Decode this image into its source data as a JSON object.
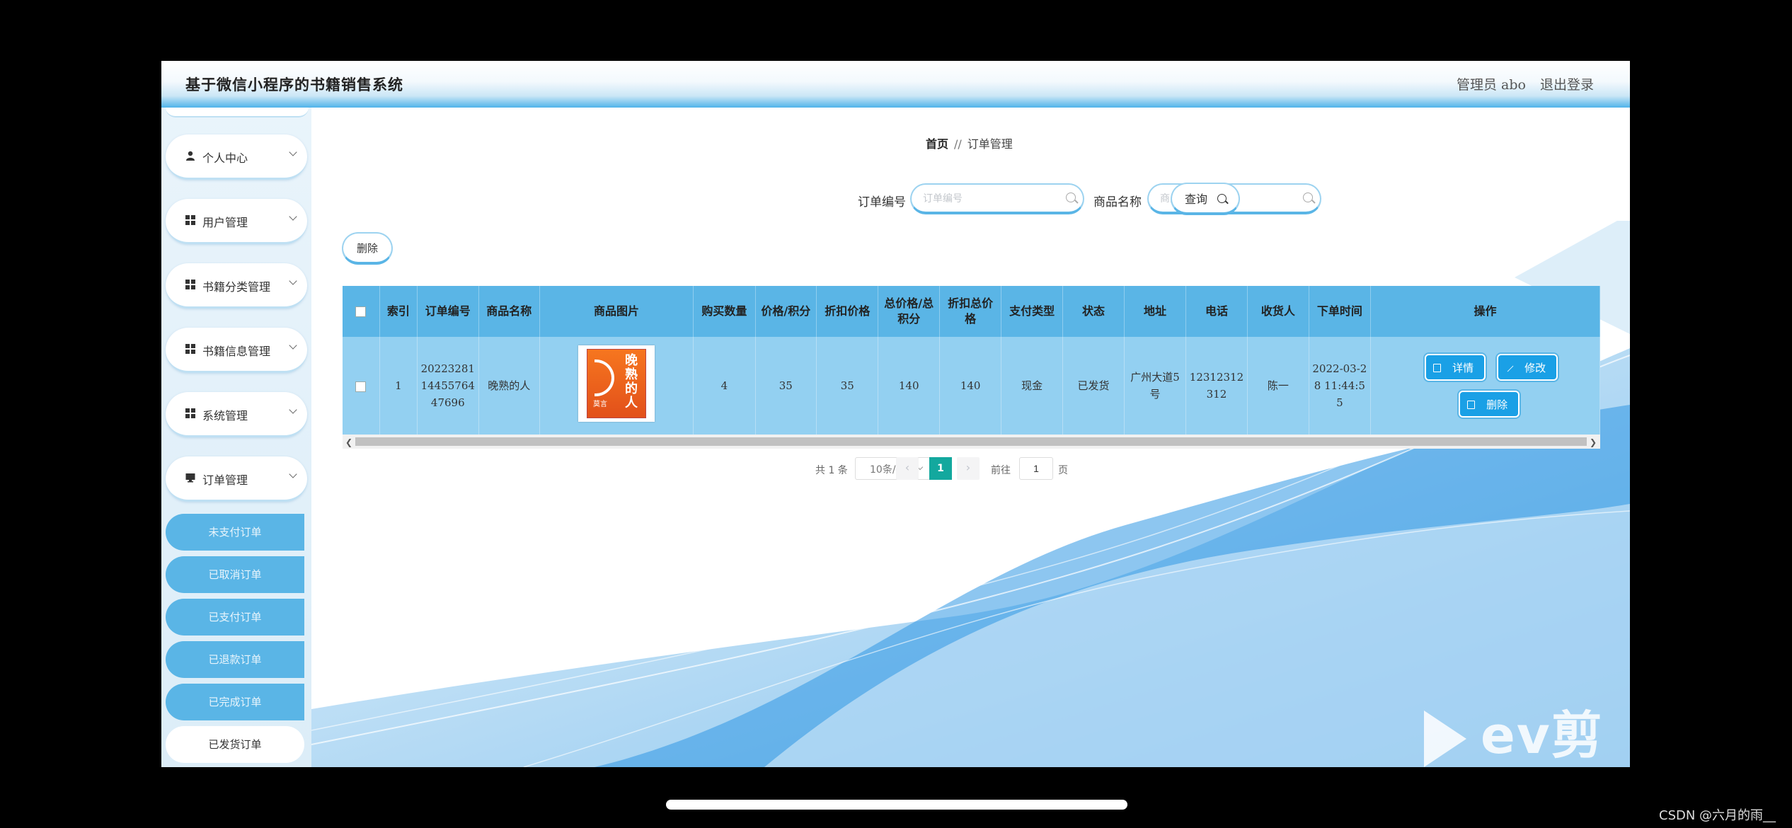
{
  "header": {
    "title": "基于微信小程序的书籍销售系统",
    "admin_label": "管理员 abo",
    "logout": "退出登录"
  },
  "sidebar": {
    "items": [
      {
        "label": "个人中心",
        "icon": "user-icon"
      },
      {
        "label": "用户管理",
        "icon": "grid-icon"
      },
      {
        "label": "书籍分类管理",
        "icon": "grid-icon"
      },
      {
        "label": "书籍信息管理",
        "icon": "grid-icon"
      },
      {
        "label": "系统管理",
        "icon": "grid-icon"
      },
      {
        "label": "订单管理",
        "icon": "monitor-icon"
      }
    ],
    "subitems": [
      "未支付订单",
      "已取消订单",
      "已支付订单",
      "已退款订单",
      "已完成订单",
      "已发货订单"
    ]
  },
  "breadcrumb": {
    "home": "首页",
    "sep": "//",
    "current": "订单管理"
  },
  "search": {
    "order_no_label": "订单编号",
    "order_no_placeholder": "订单编号",
    "product_label": "商品名称",
    "product_placeholder": "商品名称",
    "query_button": "查询"
  },
  "actions": {
    "delete_button": "删除"
  },
  "table": {
    "headers": [
      "索引",
      "订单编号",
      "商品名称",
      "商品图片",
      "购买数量",
      "价格/积分",
      "折扣价格",
      "总价格/总积分",
      "折扣总价格",
      "支付类型",
      "状态",
      "地址",
      "电话",
      "收货人",
      "下单时间",
      "操作"
    ],
    "rows": [
      {
        "index": "1",
        "order_no": "2022328114455764 47696",
        "product_name": "晚熟的人",
        "cover_title": "晚熟的人",
        "cover_author": "莫言",
        "quantity": "4",
        "price": "35",
        "discount_price": "35",
        "total_price": "140",
        "discount_total": "140",
        "pay_type": "现金",
        "status": "已发货",
        "address": "广州大道5号",
        "phone": "12312312312",
        "receiver": "陈一",
        "order_time": "2022-03-28 11:44:55"
      }
    ],
    "op_detail": "详情",
    "op_edit": "修改",
    "op_delete": "删除"
  },
  "pagination": {
    "total": "共 1 条",
    "page_size": "10条/页",
    "current": "1",
    "goto": "前往",
    "goto_value": "1",
    "unit": "页"
  },
  "overlay": {
    "watermark": "ev剪辑",
    "credit": "CSDN @六月的雨__"
  },
  "colors": {
    "primary": "#5ab5e6",
    "row": "#93d0f1",
    "button": "#1aa0e6",
    "page_active": "#13a89e"
  }
}
